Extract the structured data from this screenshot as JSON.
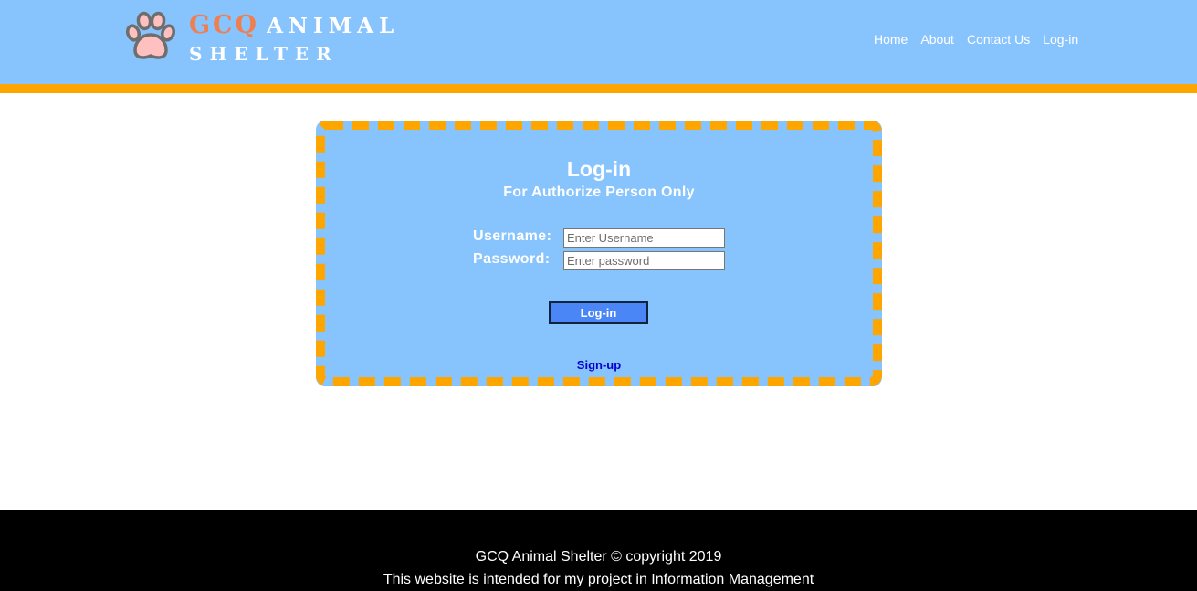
{
  "header": {
    "logo_line1_highlight": "GCQ",
    "logo_line1_rest": "ANIMAL",
    "logo_line2": "SHELTER",
    "logo_icon": "paw-icon",
    "nav": [
      "Home",
      "About",
      "Contact Us",
      "Log-in"
    ]
  },
  "login": {
    "title": "Log-in",
    "subtitle": "For Authorize Person Only",
    "username_label": "Username:",
    "username_placeholder": "Enter Username",
    "username_value": "",
    "password_label": "Password:",
    "password_placeholder": "Enter password",
    "password_value": "",
    "submit_label": "Log-in",
    "signup_label": "Sign-up"
  },
  "footer": {
    "line1": "GCQ Animal Shelter © copyright 2019",
    "line2": "This website is intended for my project in Information Management"
  },
  "colors": {
    "header_bg": "#87c3fd",
    "accent_orange": "#ffa500",
    "logo_highlight": "#f07e4e",
    "button_blue": "#4a86f5",
    "link_blue": "#0000cc",
    "footer_bg": "#000000"
  }
}
